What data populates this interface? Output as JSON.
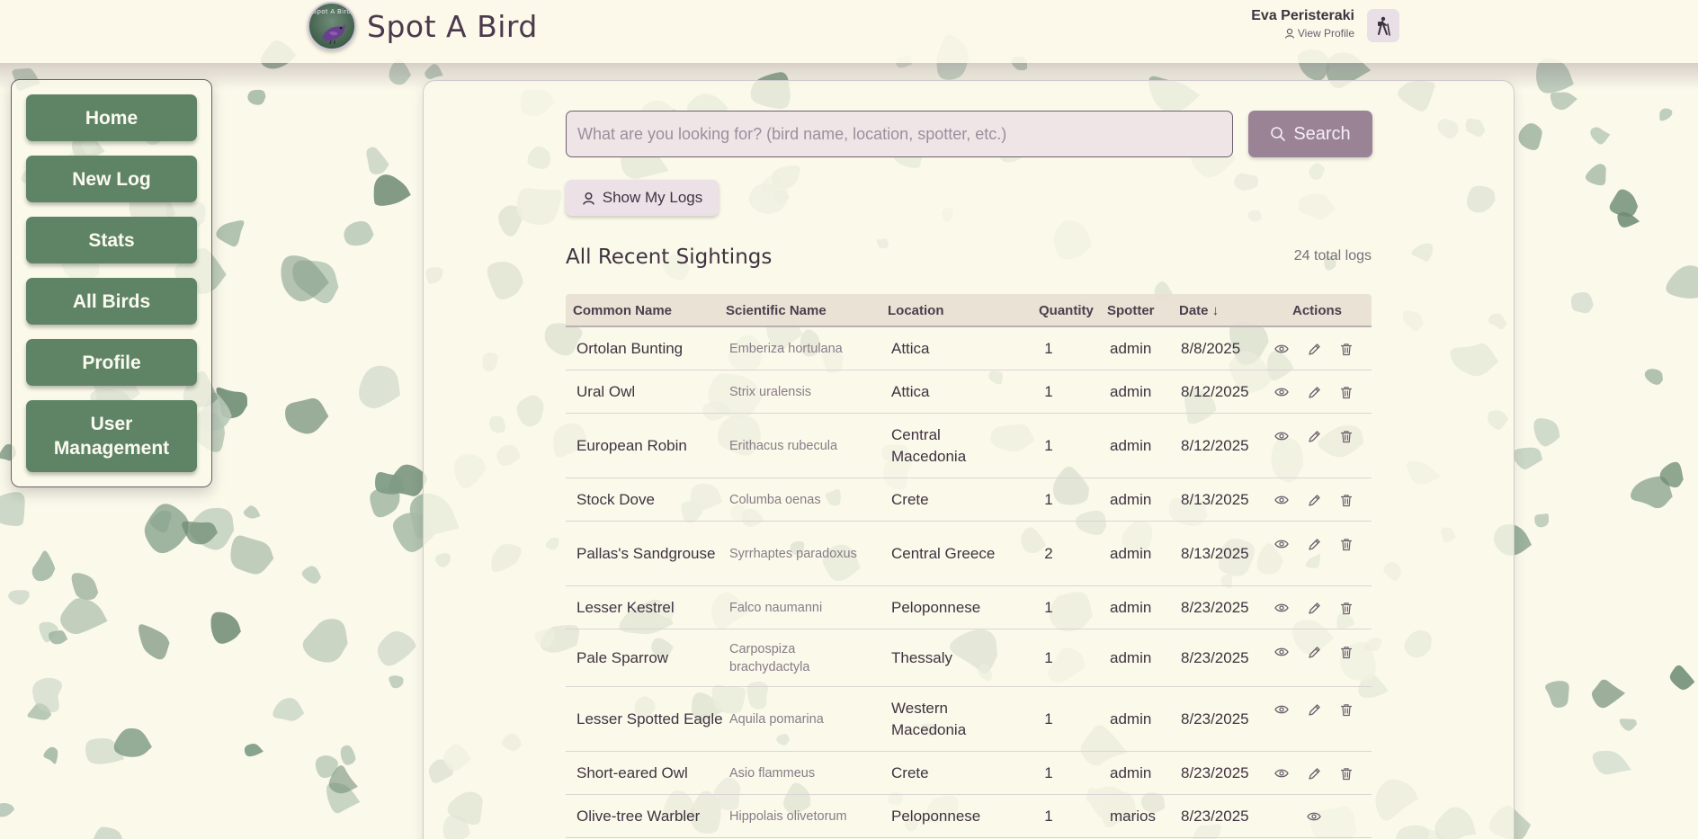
{
  "header": {
    "brand_name": "Spot A Bird",
    "logo_text": "Spot A Bird",
    "user_name": "Eva Peristeraki",
    "view_profile": "View Profile"
  },
  "sidebar": {
    "items": [
      {
        "label": "Home"
      },
      {
        "label": "New Log"
      },
      {
        "label": "Stats"
      },
      {
        "label": "All Birds"
      },
      {
        "label": "Profile"
      },
      {
        "label": "User Management"
      }
    ]
  },
  "search": {
    "placeholder": "What are you looking for? (bird name, location, spotter, etc.)",
    "button_label": "Search"
  },
  "show_my_logs_label": "Show My Logs",
  "section": {
    "title": "All Recent Sightings",
    "total": "24 total logs"
  },
  "table": {
    "headers": {
      "common": "Common Name",
      "scientific": "Scientific Name",
      "location": "Location",
      "quantity": "Quantity",
      "spotter": "Spotter",
      "date": "Date ↓",
      "actions": "Actions"
    },
    "rows": [
      {
        "common": "Ortolan Bunting",
        "scientific": "Emberiza hortulana",
        "location": "Attica",
        "quantity": "1",
        "spotter": "admin",
        "date": "8/8/2025",
        "actions": [
          "view",
          "edit",
          "delete"
        ]
      },
      {
        "common": "Ural Owl",
        "scientific": "Strix uralensis",
        "location": "Attica",
        "quantity": "1",
        "spotter": "admin",
        "date": "8/12/2025",
        "actions": [
          "view",
          "edit",
          "delete"
        ]
      },
      {
        "common": "European Robin",
        "scientific": "Erithacus rubecula",
        "location": "Central Macedonia",
        "quantity": "1",
        "spotter": "admin",
        "date": "8/12/2025",
        "actions": [
          "view",
          "edit",
          "delete"
        ]
      },
      {
        "common": "Stock Dove",
        "scientific": "Columba oenas",
        "location": "Crete",
        "quantity": "1",
        "spotter": "admin",
        "date": "8/13/2025",
        "actions": [
          "view",
          "edit",
          "delete"
        ]
      },
      {
        "common": "Pallas's Sandgrouse",
        "scientific": "Syrrhaptes paradoxus",
        "location": "Central Greece",
        "quantity": "2",
        "spotter": "admin",
        "date": "8/13/2025",
        "actions": [
          "view",
          "edit",
          "delete"
        ]
      },
      {
        "common": "Lesser Kestrel",
        "scientific": "Falco naumanni",
        "location": "Peloponnese",
        "quantity": "1",
        "spotter": "admin",
        "date": "8/23/2025",
        "actions": [
          "view",
          "edit",
          "delete"
        ]
      },
      {
        "common": "Pale Sparrow",
        "scientific": "Carpospiza brachydactyla",
        "location": "Thessaly",
        "quantity": "1",
        "spotter": "admin",
        "date": "8/23/2025",
        "actions": [
          "view",
          "edit",
          "delete"
        ]
      },
      {
        "common": "Lesser Spotted Eagle",
        "scientific": "Aquila pomarina",
        "location": "Western Macedonia",
        "quantity": "1",
        "spotter": "admin",
        "date": "8/23/2025",
        "actions": [
          "view",
          "edit",
          "delete"
        ]
      },
      {
        "common": "Short-eared Owl",
        "scientific": "Asio flammeus",
        "location": "Crete",
        "quantity": "1",
        "spotter": "admin",
        "date": "8/23/2025",
        "actions": [
          "view",
          "edit",
          "delete"
        ]
      },
      {
        "common": "Olive-tree Warbler",
        "scientific": "Hippolais olivetorum",
        "location": "Peloponnese",
        "quantity": "1",
        "spotter": "marios",
        "date": "8/23/2025",
        "actions": [
          "view"
        ]
      }
    ]
  },
  "colors": {
    "background": "#fbf9ea",
    "nav_button": "#5f8465",
    "search_button": "#9b8396",
    "blob_green": "#7f9c86",
    "text_dark": "#3f3341"
  }
}
